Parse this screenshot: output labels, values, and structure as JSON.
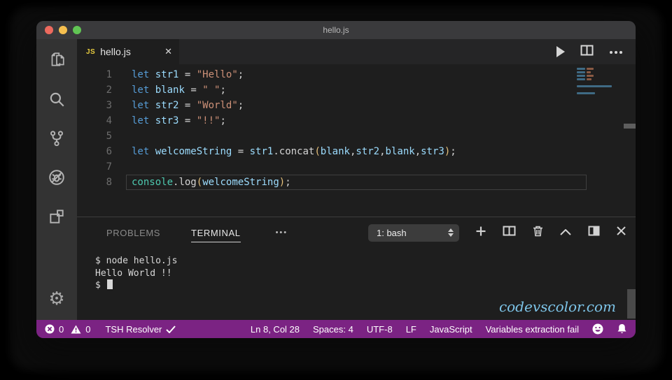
{
  "window": {
    "title": "hello.js"
  },
  "titlebar": {
    "close_color": "#ed6a5e",
    "minimize_color": "#f5bf4f",
    "zoom_color": "#61c554"
  },
  "activity_bar": {
    "items": [
      {
        "name": "explorer"
      },
      {
        "name": "search"
      },
      {
        "name": "source-control"
      },
      {
        "name": "debug"
      },
      {
        "name": "extensions"
      }
    ],
    "settings_glyph": "⚙"
  },
  "tab": {
    "file_badge": "JS",
    "label": "hello.js",
    "close_glyph": "✕"
  },
  "editor_actions": {
    "more_glyph": "•••"
  },
  "editor": {
    "token_colors": {
      "kw": "#569CD6",
      "vr": "#9CDCFE",
      "pl": "#D4D4D4",
      "st": "#CE9178",
      "cl": "#4EC9B0",
      "fn": "#D4D4D4",
      "br": "#E5C07B"
    },
    "lines": [
      {
        "n": "1",
        "tokens": [
          [
            "let",
            "kw"
          ],
          [
            " ",
            "pl"
          ],
          [
            "str1",
            "vr"
          ],
          [
            " = ",
            "pl"
          ],
          [
            "\"Hello\"",
            "st"
          ],
          [
            ";",
            "pl"
          ]
        ]
      },
      {
        "n": "2",
        "tokens": [
          [
            "let",
            "kw"
          ],
          [
            " ",
            "pl"
          ],
          [
            "blank",
            "vr"
          ],
          [
            " = ",
            "pl"
          ],
          [
            "\" \"",
            "st"
          ],
          [
            ";",
            "pl"
          ]
        ]
      },
      {
        "n": "3",
        "tokens": [
          [
            "let",
            "kw"
          ],
          [
            " ",
            "pl"
          ],
          [
            "str2",
            "vr"
          ],
          [
            " = ",
            "pl"
          ],
          [
            "\"World\"",
            "st"
          ],
          [
            ";",
            "pl"
          ]
        ]
      },
      {
        "n": "4",
        "tokens": [
          [
            "let",
            "kw"
          ],
          [
            " ",
            "pl"
          ],
          [
            "str3",
            "vr"
          ],
          [
            " = ",
            "pl"
          ],
          [
            "\"!!\"",
            "st"
          ],
          [
            ";",
            "pl"
          ]
        ]
      },
      {
        "n": "5",
        "tokens": []
      },
      {
        "n": "6",
        "tokens": [
          [
            "let",
            "kw"
          ],
          [
            " ",
            "pl"
          ],
          [
            "welcomeString",
            "vr"
          ],
          [
            " = ",
            "pl"
          ],
          [
            "str1",
            "vr"
          ],
          [
            ".",
            "pl"
          ],
          [
            "concat",
            "fn"
          ],
          [
            "(",
            "br"
          ],
          [
            "blank",
            "vr"
          ],
          [
            ",",
            "pl"
          ],
          [
            "str2",
            "vr"
          ],
          [
            ",",
            "pl"
          ],
          [
            "blank",
            "vr"
          ],
          [
            ",",
            "pl"
          ],
          [
            "str3",
            "vr"
          ],
          [
            ")",
            "br"
          ],
          [
            ";",
            "pl"
          ]
        ]
      },
      {
        "n": "7",
        "tokens": []
      },
      {
        "n": "8",
        "tokens": [
          [
            "console",
            "cl"
          ],
          [
            ".",
            "pl"
          ],
          [
            "log",
            "fn"
          ],
          [
            "(",
            "br"
          ],
          [
            "welcomeString",
            "vr"
          ],
          [
            ")",
            "br"
          ],
          [
            ";",
            "pl"
          ]
        ]
      }
    ],
    "minimap_rows": [
      [
        [
          12,
          "#3f6a84"
        ],
        [
          10,
          "#8a5a44"
        ]
      ],
      [
        [
          12,
          "#3f6a84"
        ],
        [
          6,
          "#8a5a44"
        ]
      ],
      [
        [
          12,
          "#3f6a84"
        ],
        [
          10,
          "#8a5a44"
        ]
      ],
      [
        [
          12,
          "#3f6a84"
        ],
        [
          7,
          "#8a5a44"
        ]
      ],
      [],
      [
        [
          50,
          "#3f6a84"
        ]
      ],
      [],
      [
        [
          26,
          "#3f6a84"
        ]
      ]
    ]
  },
  "panel": {
    "tabs": [
      {
        "label": "PROBLEMS",
        "active": false
      },
      {
        "label": "TERMINAL",
        "active": true
      }
    ],
    "more_glyph": "•••",
    "shell_select": {
      "value": "1: bash"
    }
  },
  "terminal": {
    "lines": [
      "$ node hello.js",
      "Hello World !!"
    ],
    "prompt": "$ "
  },
  "watermark": "codevscolor.com",
  "status_bar": {
    "background": "#7b2383",
    "error_count": "0",
    "warning_count": "0",
    "resolver_label": "TSH Resolver",
    "line_col": "Ln 8, Col 28",
    "spaces": "Spaces: 4",
    "encoding": "UTF-8",
    "eol": "LF",
    "language": "JavaScript",
    "message": "Variables extraction fail"
  }
}
